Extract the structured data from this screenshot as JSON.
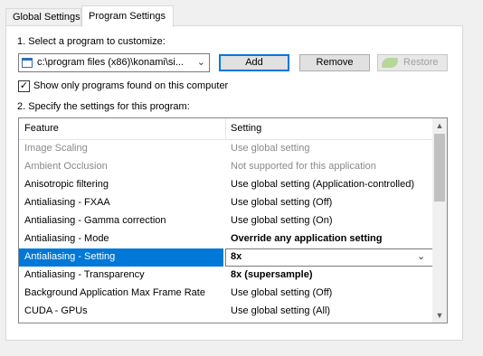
{
  "tabs": [
    {
      "label": "Global Settings",
      "active": false
    },
    {
      "label": "Program Settings",
      "active": true
    }
  ],
  "step1": {
    "label": "1. Select a program to customize:"
  },
  "program_select": {
    "value": "c:\\program files (x86)\\konami\\si..."
  },
  "buttons": {
    "add": "Add",
    "remove": "Remove",
    "restore": "Restore"
  },
  "show_only": {
    "label": "Show only programs found on this computer",
    "checked": true
  },
  "step2": {
    "label": "2. Specify the settings for this program:"
  },
  "settings_table": {
    "columns": [
      "Feature",
      "Setting"
    ],
    "rows": [
      {
        "feature": "Image Scaling",
        "setting": "Use global setting",
        "state": "disabled"
      },
      {
        "feature": "Ambient Occlusion",
        "setting": "Not supported for this application",
        "state": "disabled"
      },
      {
        "feature": "Anisotropic filtering",
        "setting": "Use global setting (Application-controlled)",
        "state": "normal"
      },
      {
        "feature": "Antialiasing - FXAA",
        "setting": "Use global setting (Off)",
        "state": "normal"
      },
      {
        "feature": "Antialiasing - Gamma correction",
        "setting": "Use global setting (On)",
        "state": "normal"
      },
      {
        "feature": "Antialiasing - Mode",
        "setting": "Override any application setting",
        "state": "bold"
      },
      {
        "feature": "Antialiasing - Setting",
        "setting": "8x",
        "state": "selected"
      },
      {
        "feature": "Antialiasing - Transparency",
        "setting": "8x (supersample)",
        "state": "bold"
      },
      {
        "feature": "Background Application Max Frame Rate",
        "setting": "Use global setting (Off)",
        "state": "normal"
      },
      {
        "feature": "CUDA - GPUs",
        "setting": "Use global setting (All)",
        "state": "normal"
      }
    ]
  },
  "colors": {
    "selection": "#0078d7",
    "disabled_text": "#8a8a8a",
    "nvidia_green": "#b7d79a"
  },
  "icons": [
    "window-icon",
    "chevron-down-icon",
    "nvidia-logo-icon",
    "checkmark-icon",
    "scroll-up-icon",
    "scroll-down-icon"
  ]
}
